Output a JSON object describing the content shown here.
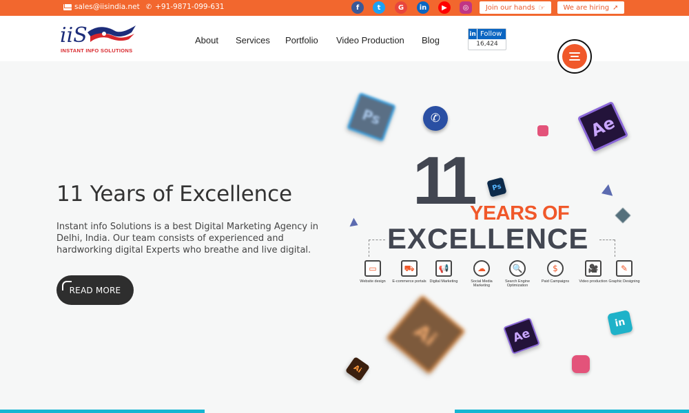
{
  "topbar": {
    "email": "sales@iisindia.net",
    "phone": "+91-9871-099-631",
    "social": [
      {
        "name": "facebook-icon",
        "glyph": "f",
        "color": "#3b5998"
      },
      {
        "name": "twitter-icon",
        "glyph": "t",
        "color": "#1da1f2"
      },
      {
        "name": "google-icon",
        "glyph": "G",
        "color": "#e8453c"
      },
      {
        "name": "linkedin-icon",
        "glyph": "in",
        "color": "#0a66c2"
      },
      {
        "name": "youtube-icon",
        "glyph": "▶",
        "color": "#ff0000"
      },
      {
        "name": "instagram-icon",
        "glyph": "◎",
        "color": "#c13584"
      }
    ],
    "join_label": "Join our hands",
    "hiring_label": "We are hiring"
  },
  "header": {
    "logo_text": "INSTANT INFO SOLUTIONS",
    "nav": [
      "About",
      "Services",
      "Portfolio",
      "Video Production",
      "Blog"
    ],
    "linkedin_follow": "Follow",
    "linkedin_count": "16,424"
  },
  "hero": {
    "title": "11 Years of Excellence",
    "description": "Instant info Solutions is a best Digital Marketing Agency in Delhi, India. Our team consists of experienced and hardworking digital Experts who breathe and live digital.",
    "read_more": "READ MORE"
  },
  "graphic": {
    "big_number": "11",
    "years_of": "YEARS OF",
    "excellence": "EXCELLENCE",
    "services": [
      {
        "label": "Website design",
        "icon": "monitor-icon"
      },
      {
        "label": "E-commerce portals",
        "icon": "cart-icon"
      },
      {
        "label": "Digital Marketing",
        "icon": "megaphone-icon"
      },
      {
        "label": "Social Media Marketing",
        "icon": "cloud-icon"
      },
      {
        "label": "Search Engine Optimization",
        "icon": "seo-icon"
      },
      {
        "label": "Paid Campaigns",
        "icon": "dollar-icon"
      },
      {
        "label": "Video production",
        "icon": "camera-icon"
      },
      {
        "label": "Graphic Designing",
        "icon": "pen-icon"
      }
    ],
    "floating": [
      "Ps",
      "Ae",
      "Ai",
      "Ae",
      "Ai",
      "Ps"
    ]
  },
  "colors": {
    "accent": "#f2672e",
    "dark": "#2e2e2e",
    "cyan": "#16b6d2"
  }
}
